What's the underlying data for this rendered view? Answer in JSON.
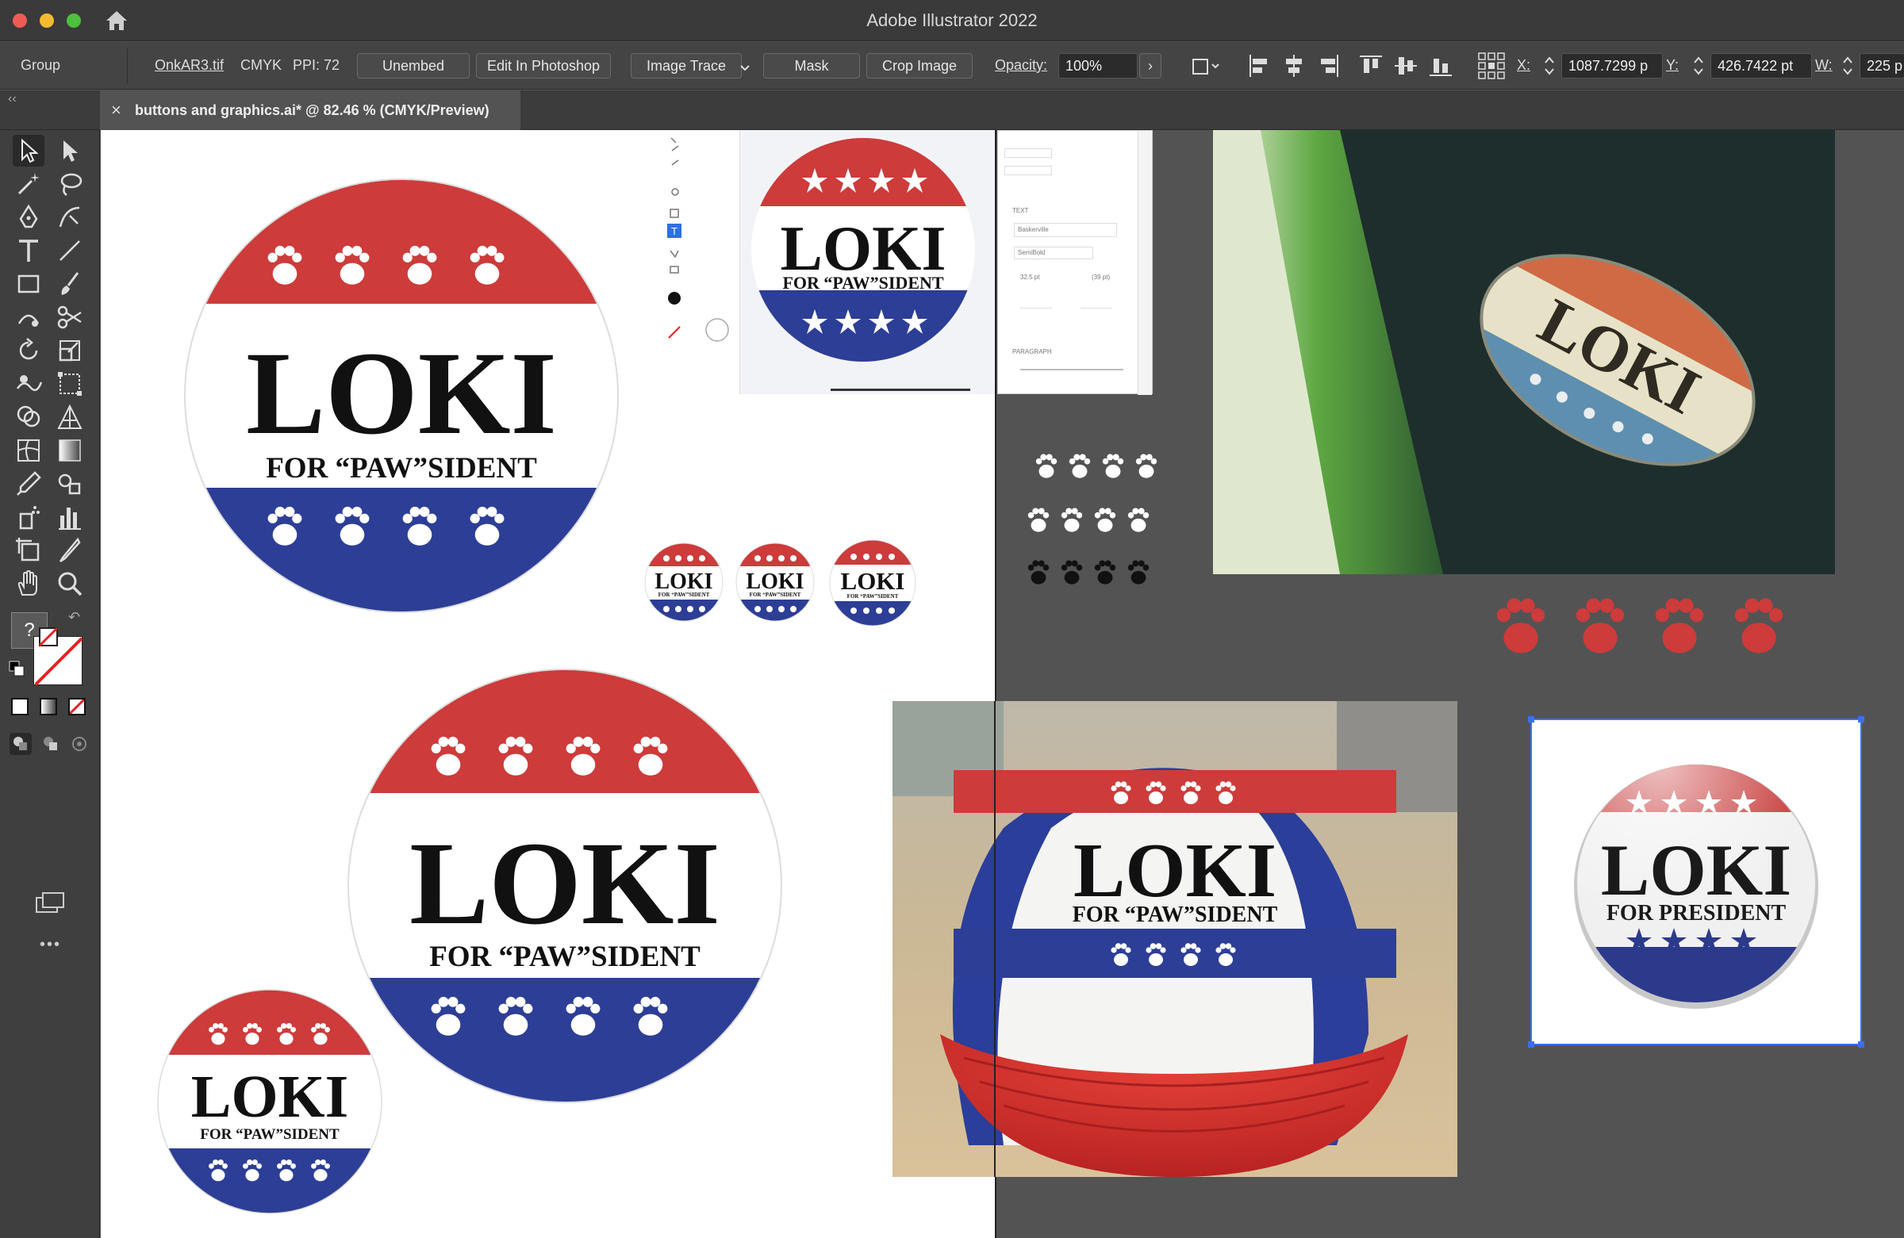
{
  "app": {
    "title": "Adobe Illustrator 2022"
  },
  "control_bar": {
    "selection": "Group",
    "linked_file": "OnkAR3.tif",
    "color_mode": "CMYK",
    "ppi": "PPI: 72",
    "embed_button": "Unembed",
    "edit_button": "Edit In Photoshop",
    "trace_button": "Image Trace",
    "mask_button": "Mask",
    "crop_button": "Crop Image",
    "opacity_label": "Opacity:",
    "opacity_value": "100%",
    "x_label": "X:",
    "x_value": "1087.7299 p",
    "y_label": "Y:",
    "y_value": "426.7422 pt",
    "w_label": "W:",
    "w_value": "225 p"
  },
  "document_tab": {
    "title": "buttons and graphics.ai* @ 82.46 % (CMYK/Preview)",
    "close": "×"
  },
  "toolbar": {
    "unknown_color": "?",
    "more": "•••"
  },
  "artwork": {
    "name": "LOKI",
    "tagline": "FOR “PAW”SIDENT",
    "alt_tagline": "FOR PRESIDENT"
  },
  "embedded_panel": {
    "section_text": "TEXT",
    "font_family": "Baskerville",
    "font_style": "SemiBold",
    "font_size": "32.5 pt",
    "leading": "(39 pt)",
    "section_paragraph": "PARAGRAPH"
  },
  "colors": {
    "red": "#CD3B3B",
    "blue": "#2D3E96",
    "black": "#111111",
    "chrome_dark": "#3a3a3a",
    "selection": "#3a6ff0",
    "hat_red": "#D8322E"
  }
}
